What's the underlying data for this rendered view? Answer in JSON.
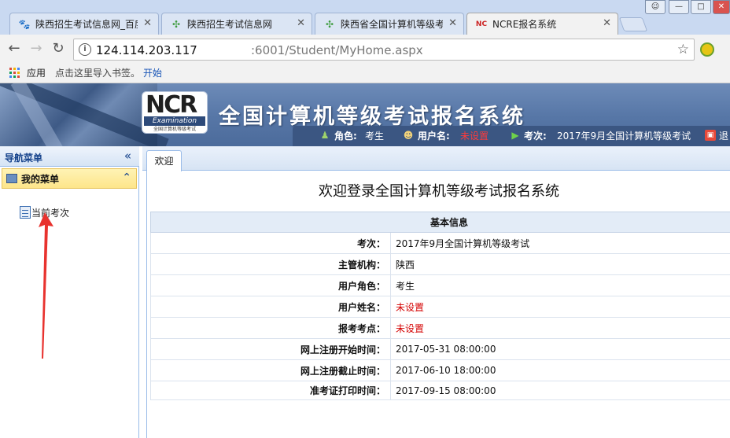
{
  "browser": {
    "tabs": [
      {
        "label": "陕西招生考试信息网_百度",
        "favicon": "paw-icon"
      },
      {
        "label": "陕西招生考试信息网",
        "favicon": "pinwheel-icon"
      },
      {
        "label": "陕西省全国计算机等级考",
        "favicon": "pinwheel-icon"
      },
      {
        "label": "NCRE报名系统",
        "favicon": "ncre-icon"
      }
    ],
    "url_host": "124.114.203.117",
    "url_path": ":6001/Student/MyHome.aspx",
    "bookmarks": {
      "apps_label": "应用",
      "import_text": "点击这里导入书签。",
      "start_link": "开始"
    }
  },
  "header": {
    "logo_text": "NCR",
    "logo_sub": "Examination",
    "logo_caption": "全国计算机等级考试",
    "title": "全国计算机等级考试报名系统",
    "role_label": "角色:",
    "role_value": "考生",
    "user_label": "用户名:",
    "user_value": "未设置",
    "exam_label": "考次:",
    "exam_value": "2017年9月全国计算机等级考试",
    "logout_label": "退"
  },
  "nav": {
    "title": "导航菜单",
    "collapse_icon": "double-chevron-left-icon",
    "menu_title": "我的菜单",
    "menu_collapse_icon": "double-chevron-up-icon",
    "items": [
      {
        "label": "当前考次"
      }
    ]
  },
  "content": {
    "tab_label": "欢迎",
    "welcome": "欢迎登录全国计算机等级考试报名系统",
    "table_header": "基本信息",
    "rows": [
      {
        "key": "考次：",
        "value": "2017年9月全国计算机等级考试",
        "highlight": false
      },
      {
        "key": "主管机构：",
        "value": "陕西",
        "highlight": false
      },
      {
        "key": "用户角色：",
        "value": "考生",
        "highlight": false
      },
      {
        "key": "用户姓名：",
        "value": "未设置",
        "highlight": true
      },
      {
        "key": "报考考点：",
        "value": "未设置",
        "highlight": true
      },
      {
        "key": "网上注册开始时间：",
        "value": "2017-05-31 08:00:00",
        "highlight": false
      },
      {
        "key": "网上注册截止时间：",
        "value": "2017-06-10 18:00:00",
        "highlight": false
      },
      {
        "key": "准考证打印时间：",
        "value": "2017-09-15 08:00:00",
        "highlight": false
      }
    ]
  },
  "colors": {
    "header_blue": "#5676a6",
    "infobar": "#3b5682",
    "highlight_red": "#d40000",
    "annotation_arrow": "#e8322e"
  }
}
